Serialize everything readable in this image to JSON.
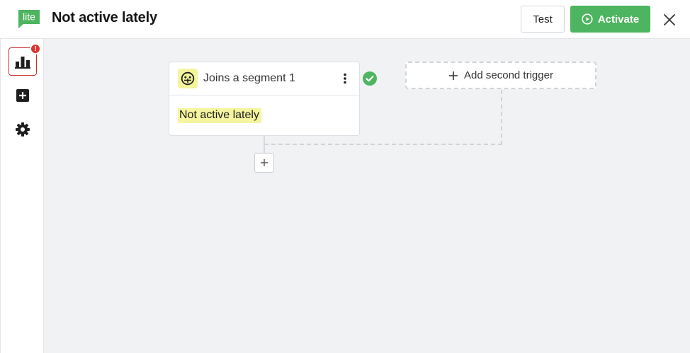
{
  "header": {
    "logo_text": "lite",
    "title": "Not active lately",
    "test_label": "Test",
    "activate_label": "Activate"
  },
  "sidebar": {
    "items": [
      {
        "name": "reports",
        "icon": "bar-chart-icon",
        "active": true,
        "badge": "!"
      },
      {
        "name": "add",
        "icon": "plus-square-icon",
        "active": false
      },
      {
        "name": "settings",
        "icon": "gear-icon",
        "active": false
      }
    ]
  },
  "workflow": {
    "trigger": {
      "icon": "segment-icon",
      "title": "Joins a segment 1",
      "segment": "Not active lately",
      "status": "valid"
    },
    "second_trigger_label": "Add second trigger"
  },
  "colors": {
    "brand_green": "#4db45f",
    "highlight_yellow": "#f6f59f",
    "badge_red": "#d9352f",
    "canvas_bg": "#f1f2f4"
  }
}
